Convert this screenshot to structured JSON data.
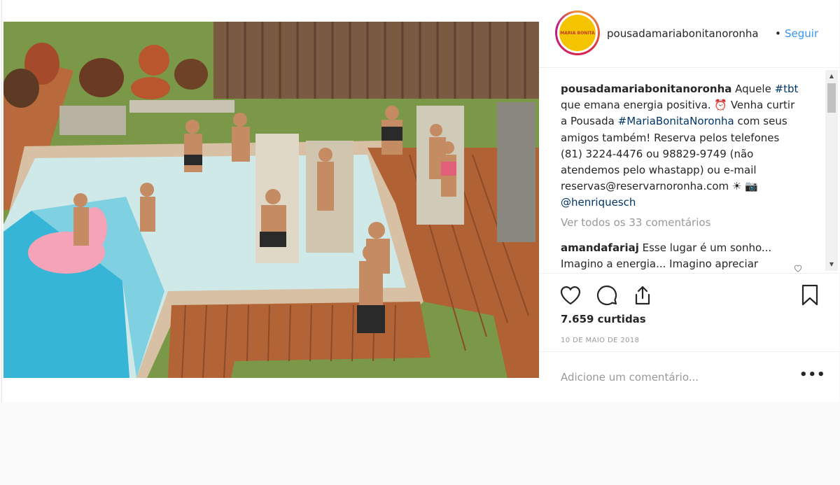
{
  "post": {
    "username": "pousadamariabonitanoronha",
    "separator": "•",
    "follow_label": "Seguir",
    "avatar_text": "MARIA BONITA",
    "caption": {
      "user": "pousadamariabonitanoronha",
      "part1": " Aquele ",
      "tag1": "#tbt",
      "part2": " que emana energia positiva. ⏰ Venha curtir a Pousada ",
      "tag2": "#MariaBonitaNoronha",
      "part3": " com seus amigos também! Reserva pelos telefones (81) 3224-4476 ou 98829-9749 (não atendemos pelo whastapp) ou e-mail reservas@reservarnoronha.com ☀ 📷 ",
      "mention": "@henriquesch"
    },
    "view_all": "Ver todos os 33 comentários",
    "comment": {
      "user": "amandafariaj",
      "text": " Esse lugar é um sonho... Imagino a energia... Imagino apreciar"
    },
    "likes": "7.659 curtidas",
    "date": "10 DE MAIO DE 2018",
    "add_comment_placeholder": "Adicione um comentário...",
    "more_label": "•••",
    "icons": {
      "like": "heart-icon",
      "comment": "comment-icon",
      "share": "share-icon",
      "save": "bookmark-icon"
    }
  }
}
